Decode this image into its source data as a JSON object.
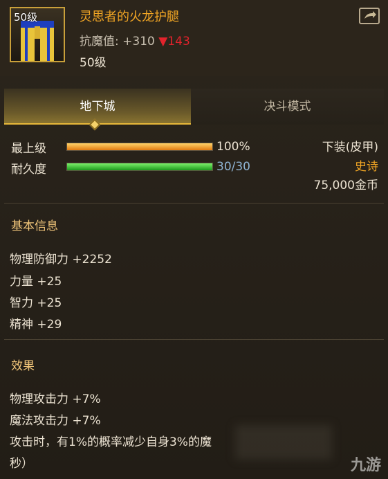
{
  "item": {
    "level_badge": "50级",
    "name": "灵思者的火龙护腿",
    "stat_label": "抗魔值: +310",
    "stat_down": "▼143",
    "level": "50级"
  },
  "tabs": [
    {
      "label": "地下城",
      "active": true
    },
    {
      "label": "决斗模式",
      "active": false
    }
  ],
  "bars": {
    "max_level": {
      "label": "最上级",
      "value": "100%",
      "fill": 1.0
    },
    "durability": {
      "label": "耐久度",
      "value": "30/30",
      "fill": 1.0
    }
  },
  "info": {
    "slot": "下装(皮甲)",
    "rarity": "史诗",
    "price": "75,000金币"
  },
  "basic": {
    "title": "基本信息",
    "lines": [
      "物理防御力 +2252",
      "力量 +25",
      "智力 +25",
      "精神 +29"
    ]
  },
  "effects": {
    "title": "效果",
    "lines": [
      "物理攻击力 +7%",
      "魔法攻击力 +7%",
      "攻击时，有1%的概率减少自身3%的魔",
      "秒）"
    ]
  },
  "watermark": "九游",
  "colors": {
    "accent": "#f2a624",
    "down": "#e2232c",
    "bg": "#241f18"
  },
  "icons": {
    "share": "share-icon",
    "item": "leg-armor-icon"
  }
}
